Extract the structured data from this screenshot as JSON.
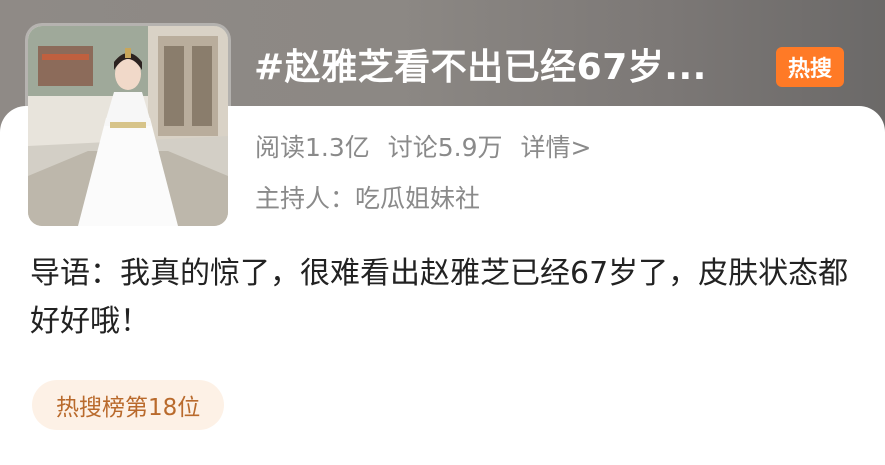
{
  "topic": {
    "title": "#赵雅芝看不出已经67岁...",
    "badge": "热搜",
    "read_label": "阅读1.3亿",
    "discuss_label": "讨论5.9万",
    "detail_label": "详情>",
    "host_label": "主持人：吃瓜姐妹社"
  },
  "lead": {
    "text": "导语：我真的惊了，很难看出赵雅芝已经67岁了，皮肤状态都好好哦！"
  },
  "rank": {
    "label": "热搜榜第18位"
  },
  "colors": {
    "badge": "#ff7a26",
    "chip_bg": "#fdf1e6",
    "chip_text": "#b96a2c",
    "meta_text": "#8a8a8a"
  }
}
